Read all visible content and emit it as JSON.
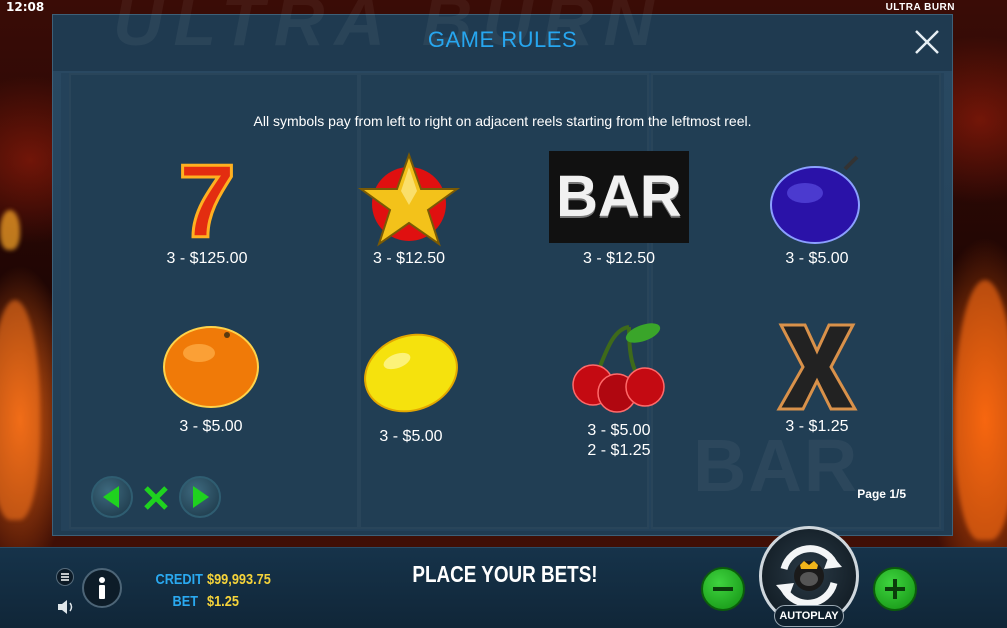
{
  "status_bar": {
    "time": "12:08",
    "game_name": "ULTRA BURN"
  },
  "modal": {
    "title": "GAME RULES",
    "intro": "All symbols pay from left to right on adjacent reels starting from the leftmost reel.",
    "page_indicator": "Page 1/5",
    "symbols": [
      {
        "name": "seven-icon",
        "payouts": [
          "3 - $125.00"
        ]
      },
      {
        "name": "star-icon",
        "payouts": [
          "3 - $12.50"
        ]
      },
      {
        "name": "bar-icon",
        "label": "BAR",
        "payouts": [
          "3 - $12.50"
        ]
      },
      {
        "name": "plum-icon",
        "payouts": [
          "3 - $5.00"
        ]
      },
      {
        "name": "orange-icon",
        "payouts": [
          "3 - $5.00"
        ]
      },
      {
        "name": "lemon-icon",
        "payouts": [
          "3 - $5.00"
        ]
      },
      {
        "name": "cherry-icon",
        "payouts": [
          "3 - $5.00",
          "2 - $1.25"
        ]
      },
      {
        "name": "x-icon",
        "payouts": [
          "3 - $1.25"
        ]
      }
    ]
  },
  "bottom_bar": {
    "credit_label": "CREDIT",
    "credit_value": "$99,993.75",
    "bet_label": "BET",
    "bet_value": "$1.25",
    "message": "PLACE YOUR BETS!",
    "autoplay_label": "AUTOPLAY",
    "seven_digit": "7"
  },
  "colors": {
    "title_blue": "#27a6ef",
    "credit_yellow": "#f5d33a",
    "nav_green": "#1fd21f",
    "button_green": "#1aa81a"
  }
}
